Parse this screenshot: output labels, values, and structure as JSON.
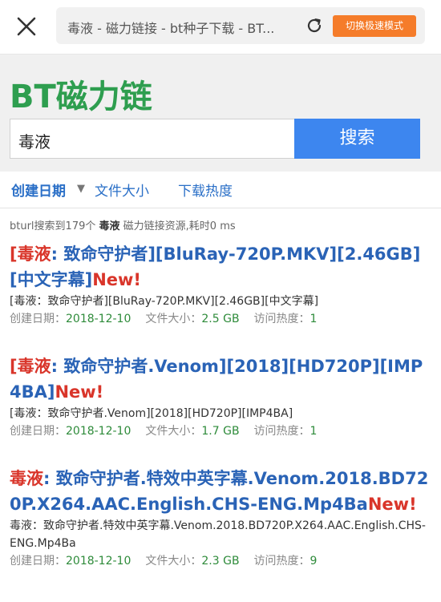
{
  "browser": {
    "url_text": "毒液 - 磁力链接 - bt种子下载 - BT...",
    "mode_button": "切换极速模式"
  },
  "header": {
    "logo": "BT磁力链",
    "search_value": "毒液",
    "search_button": "搜索"
  },
  "sort": {
    "created": "创建日期",
    "size": "文件大小",
    "heat": "下载热度"
  },
  "stats": {
    "prefix": "bturl搜索到179个",
    "keyword": "毒液",
    "suffix": "磁力链接资源,耗时0 ms"
  },
  "results": [
    {
      "title_open": "[",
      "title_keyword": "毒液",
      "title_rest": ": 致命守护者][BluRay-720P.MKV][2.46GB][中文字幕]",
      "title_new": "New!",
      "desc": "[毒液：致命守护者][BluRay-720P.MKV][2.46GB][中文字幕]",
      "created_label": "创建日期：",
      "created": "2018-12-10",
      "size_label": "文件大小：",
      "size": "2.5 GB",
      "heat_label": "访问热度：",
      "heat": "1"
    },
    {
      "title_open": "[",
      "title_keyword": "毒液",
      "title_rest": ": 致命守护者.Venom][2018][HD720P][IMP4BA]",
      "title_new": "New!",
      "desc": "[毒液：致命守护者.Venom][2018][HD720P][IMP4BA]",
      "created_label": "创建日期：",
      "created": "2018-12-10",
      "size_label": "文件大小：",
      "size": "1.7 GB",
      "heat_label": "访问热度：",
      "heat": "1"
    },
    {
      "title_open": "",
      "title_keyword": "毒液",
      "title_rest": ": 致命守护者.特效中英字幕.Venom.2018.BD720P.X264.AAC.English.CHS-ENG.Mp4Ba",
      "title_new": "New!",
      "desc": "毒液：致命守护者.特效中英字幕.Venom.2018.BD720P.X264.AAC.English.CHS-ENG.Mp4Ba",
      "created_label": "创建日期：",
      "created": "2018-12-10",
      "size_label": "文件大小：",
      "size": "2.3 GB",
      "heat_label": "访问热度：",
      "heat": "9"
    }
  ],
  "colors": {
    "brand_green": "#2e9e4f",
    "search_blue": "#3d86ef",
    "mode_orange": "#f57c2a",
    "link_blue": "#2a63b6",
    "keyword_red": "#d9352a",
    "value_green": "#2e8b3a"
  },
  "icons": {
    "close": "close-icon",
    "refresh": "refresh-icon",
    "sort_arrow": "arrow-down-icon"
  }
}
